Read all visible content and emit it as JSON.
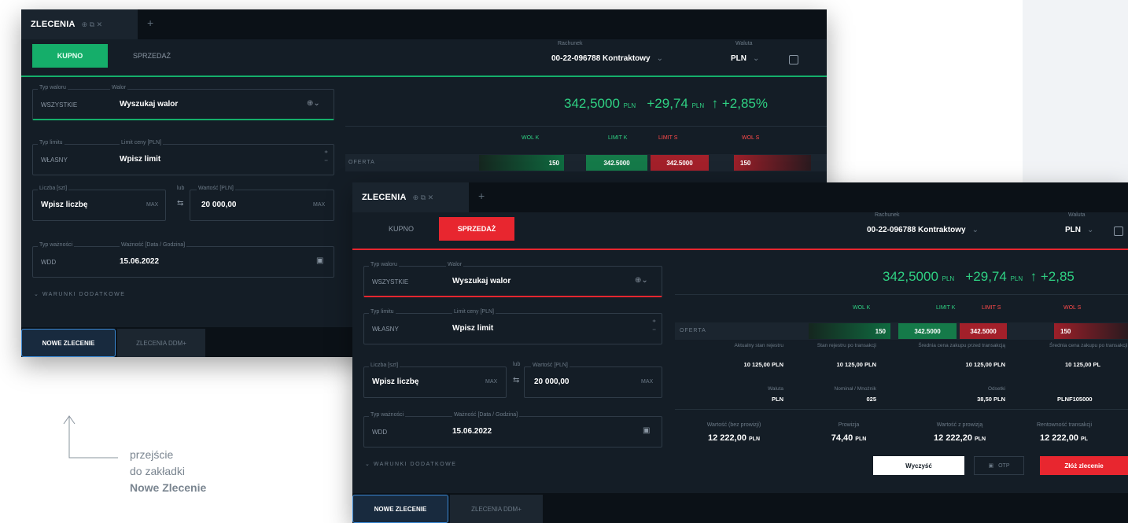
{
  "annotation": {
    "line1": "przejście",
    "line2": "do zakładki",
    "line3": "Nowe Zlecenie"
  },
  "colors": {
    "buy": "#15ae6a",
    "sell": "#e8262f",
    "positive": "#2fd183",
    "highlight": "#3a89d6"
  },
  "icons": [
    "arrow-up-icon",
    "globe-icon",
    "calendar-icon",
    "swap-icon",
    "chevron-down-icon",
    "close-icon",
    "popout-icon",
    "plus-icon",
    "document-icon"
  ],
  "window_buy": {
    "tab_title": "ZLECENIA",
    "tab_icons": "⊕ ⧉ ✕",
    "plus": "+",
    "buy_label": "KUPNO",
    "sell_label": "SPRZEDAŻ",
    "account_label": "Rachunek",
    "account_value": "00-22-096788 Kontraktowy",
    "currency_label": "Waluta",
    "currency_value": "PLN",
    "security_type_label": "Typ waloru",
    "security_type_value": "WSZYSTKIE",
    "security_label": "Walor",
    "security_value": "Wyszukaj walor",
    "limit_type_label": "Typ limitu",
    "limit_type_value": "WŁASNY",
    "limit_price_label": "Limit ceny [PLN]",
    "limit_price_value": "Wpisz limit",
    "qty_label": "Liczba [szt]",
    "qty_value": "Wpisz liczbę",
    "max": "MAX",
    "or": "lub",
    "amount_label": "Wartość [PLN]",
    "amount_value": "20 000,00",
    "validity_type_label": "Typ ważności",
    "validity_type_value": "WDD",
    "validity_label": "Ważność [Data / Godzina]",
    "validity_value": "15.06.2022",
    "conditions": "WARUNKI DODATKOWE",
    "price": "342,5000",
    "price_unit": "PLN",
    "change": "+29,74",
    "change_unit": "PLN",
    "change_pct": "↑ +2,85%",
    "col_vol_buy": "WOL K",
    "col_limit_buy": "LIMIT K",
    "col_limit_sell": "LIMIT S",
    "col_vol_sell": "WOL S",
    "offer_label": "OFERTA",
    "vol_buy": "150",
    "limit_buy": "342.5000",
    "limit_sell": "342.5000",
    "vol_sell": "150",
    "new_order": "NOWE ZLECENIE",
    "orders_ddm": "ZLECENIA DDM+"
  },
  "window_sell": {
    "tab_title": "ZLECENIA",
    "tab_icons": "⊕ ⧉ ✕",
    "plus": "+",
    "buy_label": "KUPNO",
    "sell_label": "SPRZEDAŻ",
    "account_label": "Rachunek",
    "account_value": "00-22-096788 Kontraktowy",
    "currency_label": "Waluta",
    "currency_value": "PLN",
    "security_type_label": "Typ waloru",
    "security_type_value": "WSZYSTKIE",
    "security_label": "Walor",
    "security_value": "Wyszukaj walor",
    "limit_type_label": "Typ limitu",
    "limit_type_value": "WŁASNY",
    "limit_price_label": "Limit ceny [PLN]",
    "limit_price_value": "Wpisz limit",
    "qty_label": "Liczba [szt]",
    "qty_value": "Wpisz liczbę",
    "max": "MAX",
    "or": "lub",
    "amount_label": "Wartość [PLN]",
    "amount_value": "20 000,00",
    "validity_type_label": "Typ ważności",
    "validity_type_value": "WDD",
    "validity_label": "Ważność [Data / Godzina]",
    "validity_value": "15.06.2022",
    "conditions": "WARUNKI DODATKOWE",
    "price": "342,5000",
    "price_unit": "PLN",
    "change": "+29,74",
    "change_unit": "PLN",
    "change_pct": "↑ +2,85",
    "col_vol_buy": "WOL K",
    "col_limit_buy": "LIMIT K",
    "col_limit_sell": "LIMIT S",
    "col_vol_sell": "WOL S",
    "offer_label": "OFERTA",
    "vol_buy": "150",
    "limit_buy": "342.5000",
    "limit_sell": "342.5000",
    "vol_sell": "150",
    "info": [
      {
        "label": "Aktualny stan rejestru",
        "value": "10 125,00 PLN"
      },
      {
        "label": "Stan rejestru po transakcji",
        "value": "10 125,00 PLN"
      },
      {
        "label": "Średnia cena zakupu przed transakcją",
        "value": "10 125,00 PLN"
      },
      {
        "label": "Średnia cena zakupu po transakcji",
        "value": "10 125,00 PL"
      }
    ],
    "info2": [
      {
        "label": "Waluta",
        "value": "PLN"
      },
      {
        "label": "Nominał / Mnożnik",
        "value": "025"
      },
      {
        "label": "Odsetki",
        "value": "38,50 PLN"
      },
      {
        "label": "",
        "value": "PLNF105000"
      }
    ],
    "sum_net_label": "Wartość (bez prowizji)",
    "sum_net_value": "12 222,00",
    "sum_fee_label": "Prowizja",
    "sum_fee_value": "74,40",
    "sum_gross_label": "Wartość z prowizją",
    "sum_gross_value": "12 222,20",
    "sum_profit_label": "Rentowność transakcji",
    "sum_profit_value": "12 222,00",
    "unit": "PLN",
    "unit_cut": "PL",
    "clear": "Wyczyść",
    "otp": "OTP",
    "submit": "Złóż zlecenie",
    "new_order": "NOWE ZLECENIE",
    "orders_ddm": "ZLECENIA DDM+"
  }
}
